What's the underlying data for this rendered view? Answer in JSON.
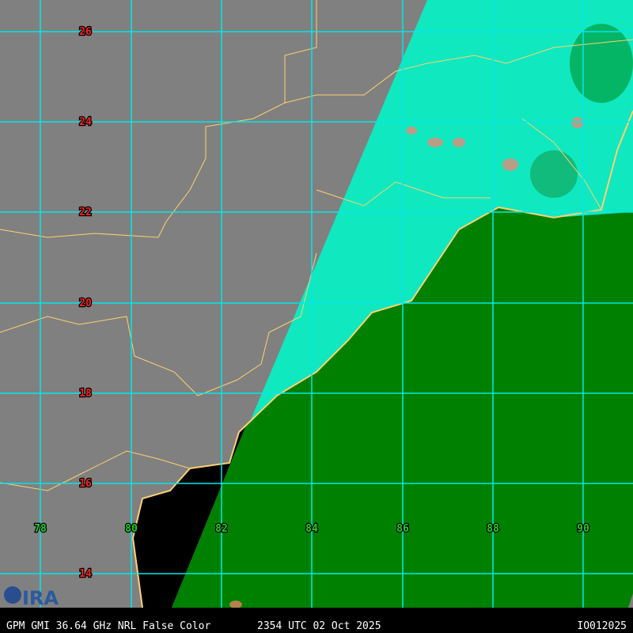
{
  "footer": {
    "product": "GPM GMI 36.64 GHz NRL False Color",
    "time": "2354 UTC 02 Oct 2025",
    "id": "IO012025"
  },
  "logo": "CIRA",
  "grid": {
    "latitudes": [
      "26",
      "24",
      "22",
      "20",
      "18",
      "16",
      "14"
    ],
    "longitudes": [
      "78",
      "80",
      "82",
      "84",
      "86",
      "88",
      "90"
    ]
  },
  "colors": {
    "land_nodata": "#808080",
    "ocean_nodata": "#000000",
    "swath_land": "#10e8c0",
    "swath_ocean": "#008000",
    "grid": "#00e8e8",
    "coast": "#ffd070",
    "lat_label": "#ff2020",
    "lon_label": "#20d020"
  }
}
